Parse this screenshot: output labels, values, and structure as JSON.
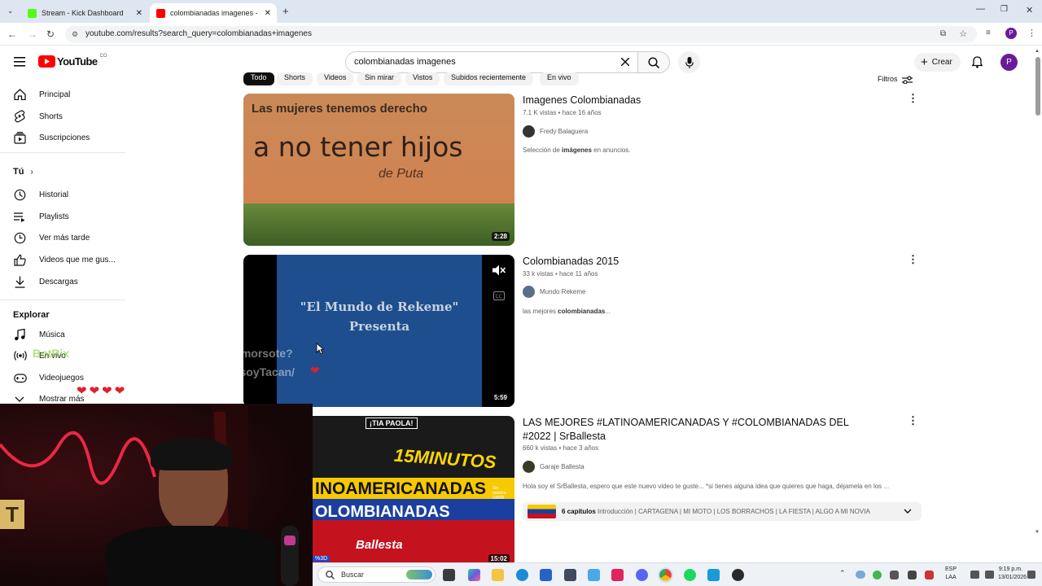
{
  "browser": {
    "tabs": [
      {
        "title": "Stream - Kick Dashboard",
        "active": false,
        "favicon_color": "#53fc18"
      },
      {
        "title": "colombianadas imagenes - You",
        "active": true,
        "favicon_color": "#ff0000"
      }
    ],
    "new_tab": "+",
    "url": "youtube.com/results?search_query=colombianadas+imagenes",
    "profile_initial": "P"
  },
  "header": {
    "logo_text": "YouTube",
    "logo_region": "CO",
    "search_value": "colombianadas imagenes",
    "create_label": "Crear",
    "avatar_initial": "P"
  },
  "sidebar": {
    "main": [
      {
        "label": "Principal",
        "icon": "home-icon"
      },
      {
        "label": "Shorts",
        "icon": "shorts-icon"
      },
      {
        "label": "Suscripciones",
        "icon": "subscriptions-icon"
      }
    ],
    "you_header": "Tú",
    "you": [
      {
        "label": "Historial",
        "icon": "history-icon"
      },
      {
        "label": "Playlists",
        "icon": "playlists-icon"
      },
      {
        "label": "Ver más tarde",
        "icon": "watch-later-icon"
      },
      {
        "label": "Videos que me gus...",
        "icon": "like-icon"
      },
      {
        "label": "Descargas",
        "icon": "download-icon"
      }
    ],
    "explore_header": "Explorar",
    "explore": [
      {
        "label": "Música",
        "icon": "music-icon"
      },
      {
        "label": "En vivo",
        "icon": "live-icon"
      },
      {
        "label": "Videojuegos",
        "icon": "gaming-icon"
      },
      {
        "label": "Mostrar más",
        "icon": "chevron-down-icon"
      }
    ]
  },
  "chips": [
    "Todo",
    "Shorts",
    "Videos",
    "Sin mirar",
    "Vistos",
    "Subidos recientemente",
    "En vivo"
  ],
  "filters_label": "Filtros",
  "results": [
    {
      "title": "Imagenes Colombianadas",
      "views": "7.1 K vistas",
      "age": "hace 16 años",
      "channel": "Fredy Balaguera",
      "desc_pre": "Selección de ",
      "desc_bold": "imágenes",
      "desc_post": " en anuncios.",
      "duration": "2:28",
      "thumb_line1": "Las mujeres tenemos derecho",
      "thumb_line2": "a no tener hijos",
      "thumb_line3": "de Puta"
    },
    {
      "title": "Colombianadas 2015",
      "views": "33 k vistas",
      "age": "hace 11 años",
      "channel": "Mundo Rekeme",
      "desc_pre": "las mejores ",
      "desc_bold": "colombianadas",
      "desc_post": "...",
      "duration": "5:59",
      "thumb_line1": "\"El Mundo de Rekeme\"",
      "thumb_line2": "Presenta"
    },
    {
      "title": "LAS MEJORES #LATINOAMERICANADAS Y #COLOMBIANADAS DEL #2022 | SrBallesta",
      "views": "660 k vistas",
      "age": "hace 3 años",
      "channel": "Garaje Ballesta",
      "desc": "Hola soy el SrBallesta, espero que este nuevo video te guste... *si tienes alguna idea que quieres que haga, déjamela en los ...",
      "chapters_count": "6 capítulos",
      "chapters_list": "Introducción | CARTAGENA | MI MOTO | LOS BORRACHOS | LA FIESTA | ALGO A MI NOVIA",
      "duration": "15:02",
      "thumb_badge": "¡TIA PAOLA!",
      "thumb_line1": "15MINUTOS",
      "thumb_line2": "INOAMERICANADAS",
      "thumb_line3": "OLOMBIANADAS",
      "thumb_line4": "Ballesta",
      "thumb_side": "Sin palabra GNRB"
    }
  ],
  "overlay_chat": {
    "user": "BotRix",
    "line1": "Ya me sigue en instagram mi amorsote?",
    "line2": "https://www.instagram.com/yosoyTacan/",
    "hearts": "❤❤❤❤"
  },
  "webcam": {
    "letter": "T"
  },
  "taskbar": {
    "search_placeholder": "Buscar",
    "lang1": "ESP",
    "lang2": "LAA",
    "time": "9:19 p.m.",
    "date": "13/01/2026",
    "tag": "%3D"
  }
}
